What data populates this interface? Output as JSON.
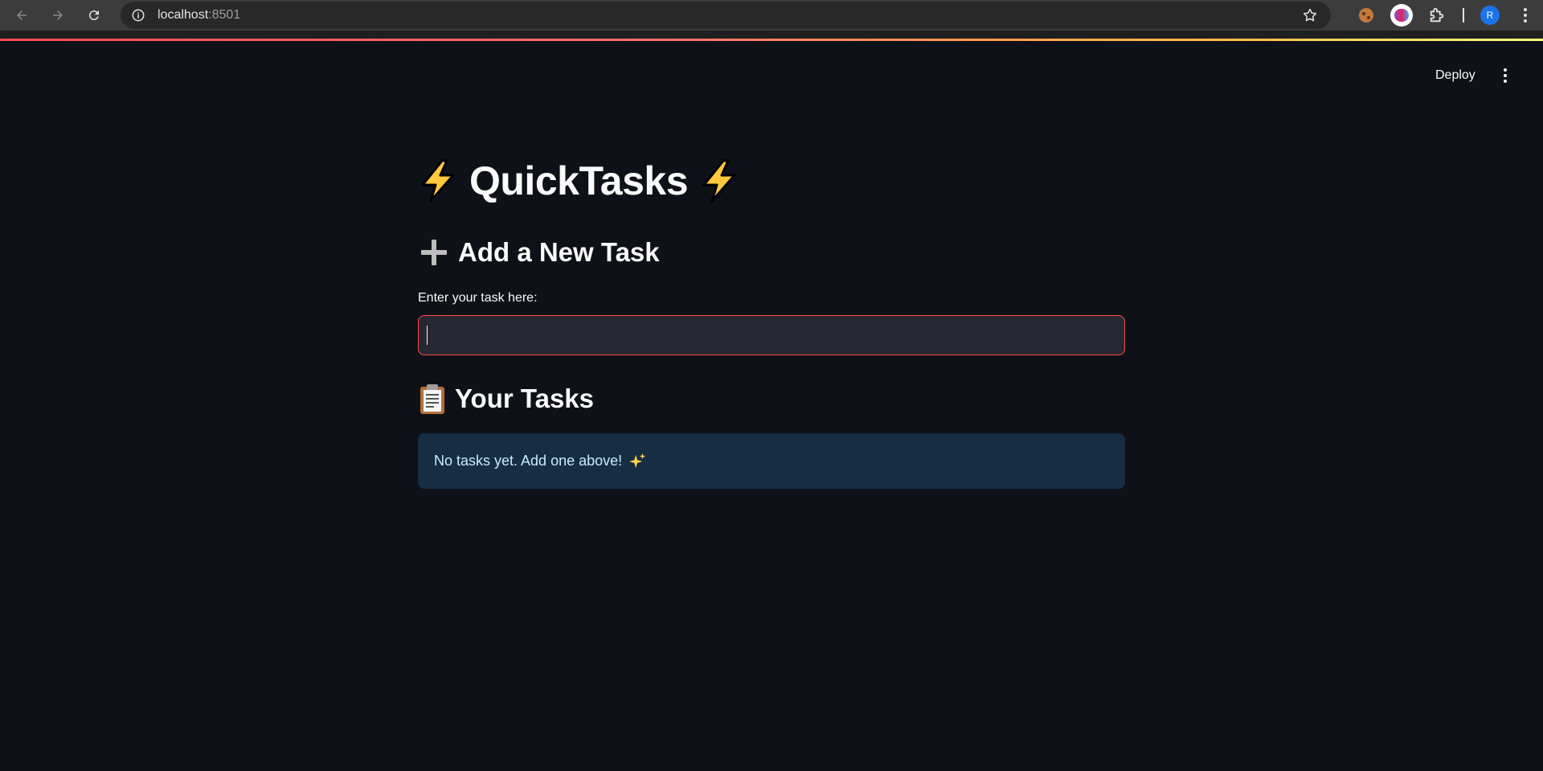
{
  "browser": {
    "url_host": "localhost",
    "url_port": ":8501",
    "avatar_letter": "R"
  },
  "header": {
    "deploy_label": "Deploy"
  },
  "main": {
    "title": "QuickTasks",
    "add_section_title": "Add a New Task",
    "input_label": "Enter your task here:",
    "input_value": "",
    "tasks_section_title": "Your Tasks",
    "empty_message": "No tasks yet. Add one above!"
  },
  "icons": {
    "title_left": "lightning-bolt-icon",
    "title_right": "lightning-bolt-icon",
    "add_section": "plus-icon",
    "tasks_section": "clipboard-icon",
    "empty_message": "sparkles-icon"
  },
  "colors": {
    "background": "#0e1117",
    "input_border_focus": "#ff4b4b",
    "input_background": "#262730",
    "info_background": "#172d43",
    "info_text": "#c7ebff"
  }
}
